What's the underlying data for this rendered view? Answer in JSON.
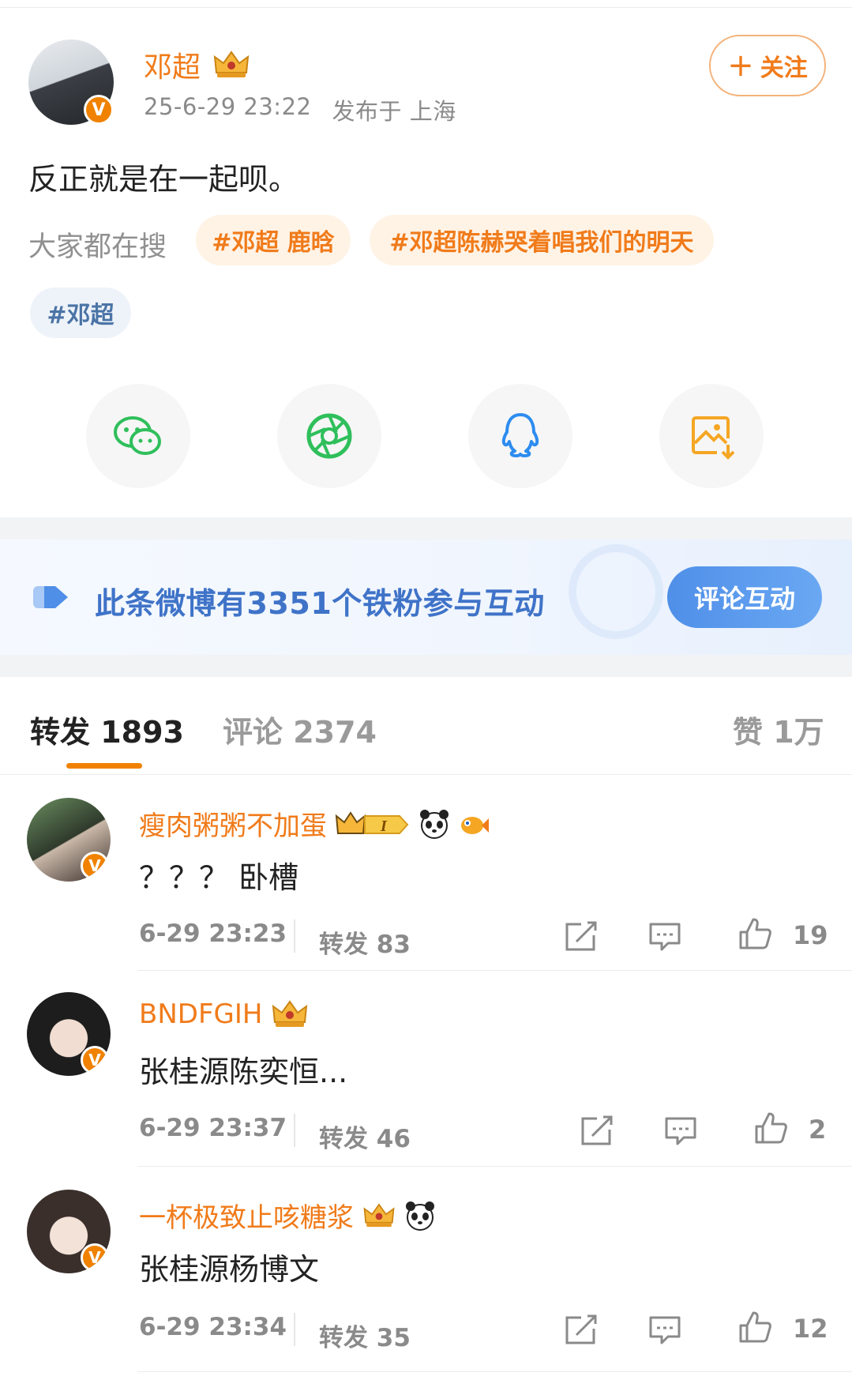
{
  "post": {
    "author": "邓超",
    "author_badge_icon": "crown-icon",
    "time": "25-6-29 23:22",
    "location": "发布于 上海",
    "follow_label": "关注",
    "text": "反正就是在一起呗。",
    "search_label": "大家都在搜",
    "tags": [
      "#邓超 鹿晗",
      "#邓超陈赫哭着唱我们的明天",
      "#邓超"
    ]
  },
  "share": {
    "items": [
      "wechat-icon",
      "moments-icon",
      "qq-icon",
      "save-image-icon"
    ]
  },
  "fans_banner": {
    "text": "此条微博有3351个铁粉参与互动",
    "button": "评论互动"
  },
  "tabs": {
    "repost": "转发 1893",
    "comment": "评论 2374",
    "like": "赞 1万"
  },
  "reposts": [
    {
      "name": "瘦肉粥粥不加蛋",
      "text": "？？？ 卧槽",
      "time": "6-29 23:23",
      "repost": "转发 83",
      "likes": "19"
    },
    {
      "name": "BNDFGIH",
      "text": "张桂源陈奕恒...",
      "time": "6-29 23:37",
      "repost": "转发 46",
      "likes": "2"
    },
    {
      "name": "一杯极致止咳糖浆",
      "text": "张桂源杨博文",
      "time": "6-29 23:34",
      "repost": "转发 35",
      "likes": "12"
    }
  ],
  "colors": {
    "accent_orange": "#f07b1a",
    "link_blue": "#3f73c8",
    "tag_blue": "#4b74a6"
  }
}
